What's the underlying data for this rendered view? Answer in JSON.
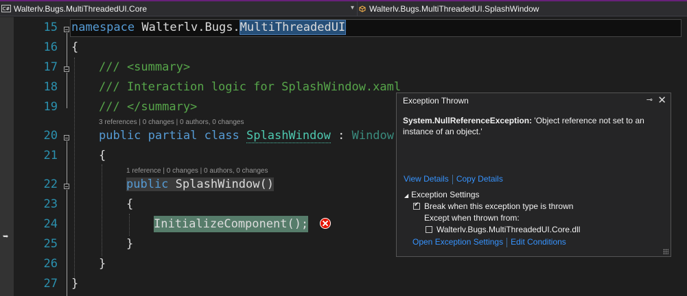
{
  "nav": {
    "project": "Walterlv.Bugs.MultiThreadedUI.Core",
    "project_icon": "C#",
    "member": "Walterlv.Bugs.MultiThreadedUI.SplashWindow"
  },
  "editor": {
    "line_numbers": [
      "15",
      "16",
      "17",
      "18",
      "19",
      "20",
      "21",
      "22",
      "23",
      "24",
      "25",
      "26",
      "27"
    ],
    "ns_kw": "namespace",
    "ns_name_a": "Walterlv.Bugs.",
    "ns_name_b": "MultiThreadedUI",
    "brace_open": "{",
    "brace_close": "}",
    "summary_open": "/// <summary>",
    "summary_text": "/// Interaction logic for SplashWindow.xaml",
    "summary_close": "/// </summary>",
    "lens_class": "3 references | 0 changes | 0 authors, 0 changes",
    "kw_public": "public",
    "kw_partial": "partial",
    "kw_class": "class",
    "class_name": "SplashWindow",
    "colon": ":",
    "base_type": "Window",
    "lens_ctor": "1 reference | 0 changes | 0 authors, 0 changes",
    "ctor_name": "SplashWindow()",
    "call": "InitializeComponent();"
  },
  "exception": {
    "title": "Exception Thrown",
    "type": "System.NullReferenceException:",
    "message": "'Object reference not set to an instance of an object.'",
    "view_details": "View Details",
    "copy_details": "Copy Details",
    "settings_header": "Exception Settings",
    "break_when": "Break when this exception type is thrown",
    "break_checked": true,
    "except_when": "Except when thrown from:",
    "module": "Walterlv.Bugs.MultiThreadedUI.Core.dll",
    "module_checked": false,
    "open_settings": "Open Exception Settings",
    "edit_conditions": "Edit Conditions"
  }
}
